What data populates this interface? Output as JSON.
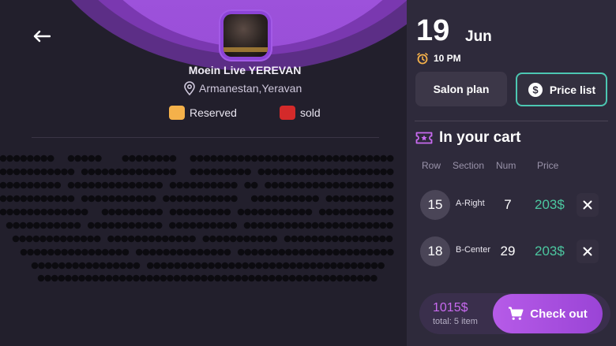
{
  "event": {
    "title": "Moein Live YEREVAN",
    "location": "Armanestan,Yeravan"
  },
  "legend": {
    "reserved_label": "Reserved",
    "sold_label": "sold",
    "reserved_color": "#f5b14a",
    "sold_color": "#d42a2a"
  },
  "date": {
    "day": "19",
    "month": "Jun",
    "time": "10 PM"
  },
  "tabs": {
    "salon_label": "Salon plan",
    "price_label": "Price list"
  },
  "cart": {
    "title": "In your cart",
    "headers": {
      "row": "Row",
      "section": "Section",
      "num": "Num",
      "price": "Price"
    },
    "items": [
      {
        "row": "15",
        "section": "A-Right",
        "num": "7",
        "price": "203$"
      },
      {
        "row": "18",
        "section": "B-Center",
        "num": "29",
        "price": "203$"
      }
    ]
  },
  "checkout": {
    "total": "1015$",
    "count": "total: 5 item",
    "button_label": "Check out"
  },
  "colors": {
    "accent": "#a552e6",
    "price_green": "#4cc7a0",
    "panel_bg": "#2e2a3b"
  }
}
